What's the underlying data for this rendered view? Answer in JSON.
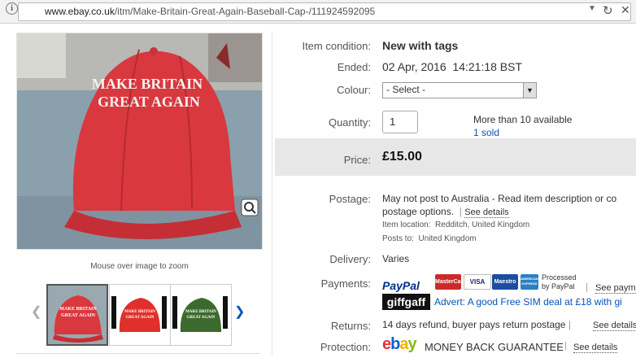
{
  "browser": {
    "url_host": "www.ebay.co.uk",
    "url_path": "/itm/Make-Britain-Great-Again-Baseball-Cap-/111924592095",
    "icons": [
      "info-icon",
      "dropdown-icon",
      "reload-icon",
      "close-icon"
    ]
  },
  "gallery": {
    "cap_text_line1": "MAKE BRITAIN",
    "cap_text_line2": "GREAT AGAIN",
    "zoom_hint": "Mouse over image to zoom",
    "thumbs": [
      {
        "line1": "MAKE BRITAIN",
        "line2": "GREAT AGAIN",
        "color": "#d9383f"
      },
      {
        "line1": "MAKE BRITAIN",
        "line2": "GREAT AGAIN",
        "color": "#e0302b"
      },
      {
        "line1": "MAKE BRITAIN",
        "line2": "GREAT AGAIN",
        "color": "#3c6a2e"
      }
    ]
  },
  "details": {
    "condition_label": "Item condition:",
    "condition_value": "New with tags",
    "ended_label": "Ended:",
    "ended_date": "02 Apr, 2016",
    "ended_time": "14:21:18 BST",
    "colour_label": "Colour:",
    "colour_value": "- Select -",
    "quantity_label": "Quantity:",
    "quantity_value": "1",
    "available": "More than 10 available",
    "sold": "1 sold",
    "price_label": "Price:",
    "price_value": "£15.00",
    "postage_label": "Postage:",
    "postage_line1": "May not post to Australia - Read item description or co",
    "postage_line2": "postage options.",
    "see_details": "See details",
    "location_label": "Item location:",
    "location_value": "Redditch, United Kingdom",
    "posts_to_label": "Posts to:",
    "posts_to_value": "United Kingdom",
    "delivery_label": "Delivery:",
    "delivery_value": "Varies",
    "payments_label": "Payments:",
    "paypal": "PayPal",
    "processed_by_1": "Processed",
    "processed_by_2": "by PayPal",
    "see_payments": "See paym",
    "cards": [
      "MasterCard",
      "VISA",
      "Maestro",
      "AMERICAN EXPRESS"
    ],
    "giffgaff": "giffgaff",
    "advert": "Advert: A good Free SIM deal at £18 with gi",
    "returns_label": "Returns:",
    "returns_value": "14 days refund, buyer pays return postage",
    "protection_label": "Protection:",
    "ebay_logo": "ebay",
    "guarantee": "MONEY BACK GUARANTEE",
    "pipe": "|"
  },
  "colors": {
    "accent_link": "#0654ba",
    "price_band": "#e7e7e7",
    "cap_red": "#d9383f"
  }
}
